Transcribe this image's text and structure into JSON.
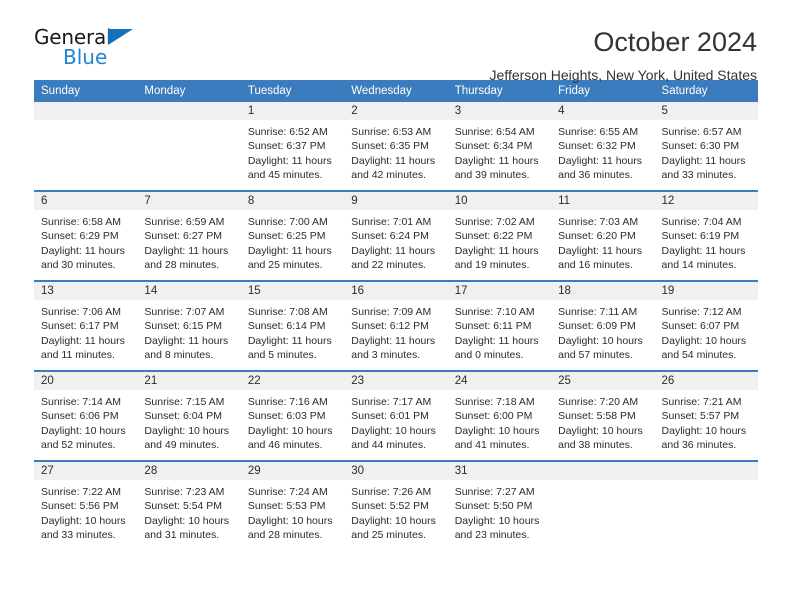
{
  "brand": {
    "name_top": "General",
    "name_bottom": "Blue",
    "accent_color": "#1c85d4",
    "triangle_color": "#1371b8"
  },
  "header": {
    "month_title": "October 2024",
    "location": "Jefferson Heights, New York, United States"
  },
  "theme": {
    "header_blue": "#3b7cbe",
    "row_band": "#f0f0f0",
    "separator": "#3b7cbe"
  },
  "weekdays": [
    "Sunday",
    "Monday",
    "Tuesday",
    "Wednesday",
    "Thursday",
    "Friday",
    "Saturday"
  ],
  "weeks": [
    [
      {
        "day": "",
        "blank": true,
        "sunrise": "",
        "sunset": "",
        "daylight1": "",
        "daylight2": ""
      },
      {
        "day": "",
        "blank": true,
        "sunrise": "",
        "sunset": "",
        "daylight1": "",
        "daylight2": ""
      },
      {
        "day": "1",
        "sunrise": "Sunrise: 6:52 AM",
        "sunset": "Sunset: 6:37 PM",
        "daylight1": "Daylight: 11 hours",
        "daylight2": "and 45 minutes."
      },
      {
        "day": "2",
        "sunrise": "Sunrise: 6:53 AM",
        "sunset": "Sunset: 6:35 PM",
        "daylight1": "Daylight: 11 hours",
        "daylight2": "and 42 minutes."
      },
      {
        "day": "3",
        "sunrise": "Sunrise: 6:54 AM",
        "sunset": "Sunset: 6:34 PM",
        "daylight1": "Daylight: 11 hours",
        "daylight2": "and 39 minutes."
      },
      {
        "day": "4",
        "sunrise": "Sunrise: 6:55 AM",
        "sunset": "Sunset: 6:32 PM",
        "daylight1": "Daylight: 11 hours",
        "daylight2": "and 36 minutes."
      },
      {
        "day": "5",
        "sunrise": "Sunrise: 6:57 AM",
        "sunset": "Sunset: 6:30 PM",
        "daylight1": "Daylight: 11 hours",
        "daylight2": "and 33 minutes."
      }
    ],
    [
      {
        "day": "6",
        "sunrise": "Sunrise: 6:58 AM",
        "sunset": "Sunset: 6:29 PM",
        "daylight1": "Daylight: 11 hours",
        "daylight2": "and 30 minutes."
      },
      {
        "day": "7",
        "sunrise": "Sunrise: 6:59 AM",
        "sunset": "Sunset: 6:27 PM",
        "daylight1": "Daylight: 11 hours",
        "daylight2": "and 28 minutes."
      },
      {
        "day": "8",
        "sunrise": "Sunrise: 7:00 AM",
        "sunset": "Sunset: 6:25 PM",
        "daylight1": "Daylight: 11 hours",
        "daylight2": "and 25 minutes."
      },
      {
        "day": "9",
        "sunrise": "Sunrise: 7:01 AM",
        "sunset": "Sunset: 6:24 PM",
        "daylight1": "Daylight: 11 hours",
        "daylight2": "and 22 minutes."
      },
      {
        "day": "10",
        "sunrise": "Sunrise: 7:02 AM",
        "sunset": "Sunset: 6:22 PM",
        "daylight1": "Daylight: 11 hours",
        "daylight2": "and 19 minutes."
      },
      {
        "day": "11",
        "sunrise": "Sunrise: 7:03 AM",
        "sunset": "Sunset: 6:20 PM",
        "daylight1": "Daylight: 11 hours",
        "daylight2": "and 16 minutes."
      },
      {
        "day": "12",
        "sunrise": "Sunrise: 7:04 AM",
        "sunset": "Sunset: 6:19 PM",
        "daylight1": "Daylight: 11 hours",
        "daylight2": "and 14 minutes."
      }
    ],
    [
      {
        "day": "13",
        "sunrise": "Sunrise: 7:06 AM",
        "sunset": "Sunset: 6:17 PM",
        "daylight1": "Daylight: 11 hours",
        "daylight2": "and 11 minutes."
      },
      {
        "day": "14",
        "sunrise": "Sunrise: 7:07 AM",
        "sunset": "Sunset: 6:15 PM",
        "daylight1": "Daylight: 11 hours",
        "daylight2": "and 8 minutes."
      },
      {
        "day": "15",
        "sunrise": "Sunrise: 7:08 AM",
        "sunset": "Sunset: 6:14 PM",
        "daylight1": "Daylight: 11 hours",
        "daylight2": "and 5 minutes."
      },
      {
        "day": "16",
        "sunrise": "Sunrise: 7:09 AM",
        "sunset": "Sunset: 6:12 PM",
        "daylight1": "Daylight: 11 hours",
        "daylight2": "and 3 minutes."
      },
      {
        "day": "17",
        "sunrise": "Sunrise: 7:10 AM",
        "sunset": "Sunset: 6:11 PM",
        "daylight1": "Daylight: 11 hours",
        "daylight2": "and 0 minutes."
      },
      {
        "day": "18",
        "sunrise": "Sunrise: 7:11 AM",
        "sunset": "Sunset: 6:09 PM",
        "daylight1": "Daylight: 10 hours",
        "daylight2": "and 57 minutes."
      },
      {
        "day": "19",
        "sunrise": "Sunrise: 7:12 AM",
        "sunset": "Sunset: 6:07 PM",
        "daylight1": "Daylight: 10 hours",
        "daylight2": "and 54 minutes."
      }
    ],
    [
      {
        "day": "20",
        "sunrise": "Sunrise: 7:14 AM",
        "sunset": "Sunset: 6:06 PM",
        "daylight1": "Daylight: 10 hours",
        "daylight2": "and 52 minutes."
      },
      {
        "day": "21",
        "sunrise": "Sunrise: 7:15 AM",
        "sunset": "Sunset: 6:04 PM",
        "daylight1": "Daylight: 10 hours",
        "daylight2": "and 49 minutes."
      },
      {
        "day": "22",
        "sunrise": "Sunrise: 7:16 AM",
        "sunset": "Sunset: 6:03 PM",
        "daylight1": "Daylight: 10 hours",
        "daylight2": "and 46 minutes."
      },
      {
        "day": "23",
        "sunrise": "Sunrise: 7:17 AM",
        "sunset": "Sunset: 6:01 PM",
        "daylight1": "Daylight: 10 hours",
        "daylight2": "and 44 minutes."
      },
      {
        "day": "24",
        "sunrise": "Sunrise: 7:18 AM",
        "sunset": "Sunset: 6:00 PM",
        "daylight1": "Daylight: 10 hours",
        "daylight2": "and 41 minutes."
      },
      {
        "day": "25",
        "sunrise": "Sunrise: 7:20 AM",
        "sunset": "Sunset: 5:58 PM",
        "daylight1": "Daylight: 10 hours",
        "daylight2": "and 38 minutes."
      },
      {
        "day": "26",
        "sunrise": "Sunrise: 7:21 AM",
        "sunset": "Sunset: 5:57 PM",
        "daylight1": "Daylight: 10 hours",
        "daylight2": "and 36 minutes."
      }
    ],
    [
      {
        "day": "27",
        "sunrise": "Sunrise: 7:22 AM",
        "sunset": "Sunset: 5:56 PM",
        "daylight1": "Daylight: 10 hours",
        "daylight2": "and 33 minutes."
      },
      {
        "day": "28",
        "sunrise": "Sunrise: 7:23 AM",
        "sunset": "Sunset: 5:54 PM",
        "daylight1": "Daylight: 10 hours",
        "daylight2": "and 31 minutes."
      },
      {
        "day": "29",
        "sunrise": "Sunrise: 7:24 AM",
        "sunset": "Sunset: 5:53 PM",
        "daylight1": "Daylight: 10 hours",
        "daylight2": "and 28 minutes."
      },
      {
        "day": "30",
        "sunrise": "Sunrise: 7:26 AM",
        "sunset": "Sunset: 5:52 PM",
        "daylight1": "Daylight: 10 hours",
        "daylight2": "and 25 minutes."
      },
      {
        "day": "31",
        "sunrise": "Sunrise: 7:27 AM",
        "sunset": "Sunset: 5:50 PM",
        "daylight1": "Daylight: 10 hours",
        "daylight2": "and 23 minutes."
      },
      {
        "day": "",
        "blank": true,
        "sunrise": "",
        "sunset": "",
        "daylight1": "",
        "daylight2": ""
      },
      {
        "day": "",
        "blank": true,
        "sunrise": "",
        "sunset": "",
        "daylight1": "",
        "daylight2": ""
      }
    ]
  ]
}
